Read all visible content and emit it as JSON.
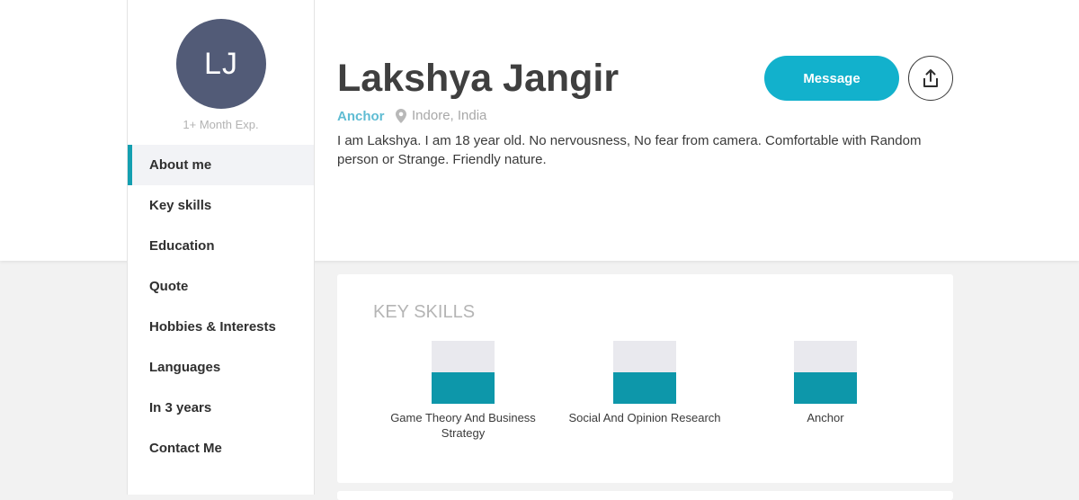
{
  "profile": {
    "initials": "LJ",
    "experience": "1+ Month Exp.",
    "name": "Lakshya Jangir",
    "role": "Anchor",
    "location": "Indore, India",
    "about": "I am Lakshya. I am 18 year old. No nervousness, No fear from camera. Comfortable with Random person or Strange. Friendly nature."
  },
  "actions": {
    "message_label": "Message",
    "share_icon": "share-icon"
  },
  "nav": {
    "items": [
      {
        "label": "About me",
        "active": true
      },
      {
        "label": "Key skills",
        "active": false
      },
      {
        "label": "Education",
        "active": false
      },
      {
        "label": "Quote",
        "active": false
      },
      {
        "label": "Hobbies & Interests",
        "active": false
      },
      {
        "label": "Languages",
        "active": false
      },
      {
        "label": "In 3 years",
        "active": false
      },
      {
        "label": "Contact Me",
        "active": false
      }
    ]
  },
  "key_skills": {
    "title": "KEY SKILLS",
    "skills": [
      {
        "name": "Game Theory And Business Strategy",
        "level": 0.5
      },
      {
        "name": "Social And Opinion Research",
        "level": 0.5
      },
      {
        "name": "Anchor",
        "level": 0.5
      }
    ]
  },
  "colors": {
    "accent": "#12b1cc",
    "nav_active_bar": "#149fb0",
    "avatar_bg": "#525b77",
    "skill_fill": "#0d97aa",
    "skill_track": "#e9e9ee"
  }
}
